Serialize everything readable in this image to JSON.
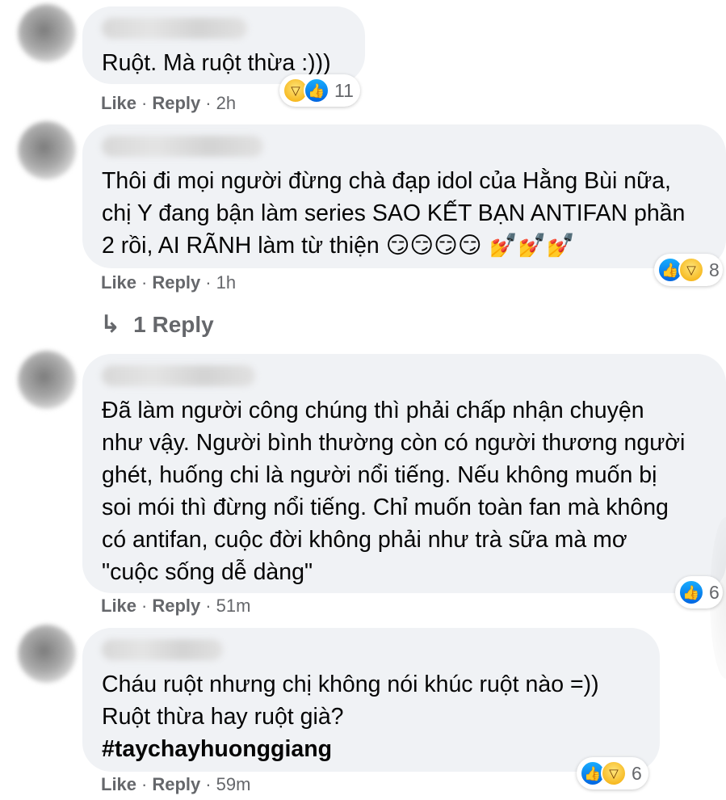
{
  "comments": [
    {
      "text": "Ruột. Mà ruột thừa :)))",
      "actions": {
        "like": "Like",
        "reply": "Reply",
        "time": "2h"
      },
      "reaction_count": "11"
    },
    {
      "text": "Thôi đi mọi người đừng chà đạp idol của Hằng Bùi nữa,\nchị Y đang bận làm series SAO KẾT BẠN ANTIFAN phần\n2 rồi, AI RÃNH làm từ thiện",
      "emojis": "😏😏😏😏 💅💅💅",
      "actions": {
        "like": "Like",
        "reply": "Reply",
        "time": "1h"
      },
      "reaction_count": "8",
      "replies_link": "1 Reply"
    },
    {
      "text": "Đã làm người công chúng thì phải chấp nhận chuyện\nnhư vậy. Người bình thường còn có người thương người\nghét, huống chi là người nổi tiếng. Nếu không muốn bị\nsoi mói thì đừng nổi tiếng. Chỉ muốn toàn fan mà không\ncó antifan, cuộc đời không phải như trà sữa mà mơ\n\"cuộc sống dễ dàng\"",
      "actions": {
        "like": "Like",
        "reply": "Reply",
        "time": "51m"
      },
      "reaction_count": "6"
    },
    {
      "text": "Cháu ruột nhưng chị không nói khúc ruột nào =))\nRuột thừa hay ruột già?",
      "hashtag": "#taychayhuonggiang",
      "actions": {
        "like": "Like",
        "reply": "Reply",
        "time": "59m"
      },
      "reaction_count": "6"
    }
  ],
  "icons": {
    "like": "thumbs-up-icon",
    "haha": "laughing-face-icon",
    "reply_arrow": "reply-arrow-icon"
  },
  "colors": {
    "bubble": "#f0f2f5",
    "secondary_text": "#65676b",
    "like_blue": "#1877f2"
  }
}
